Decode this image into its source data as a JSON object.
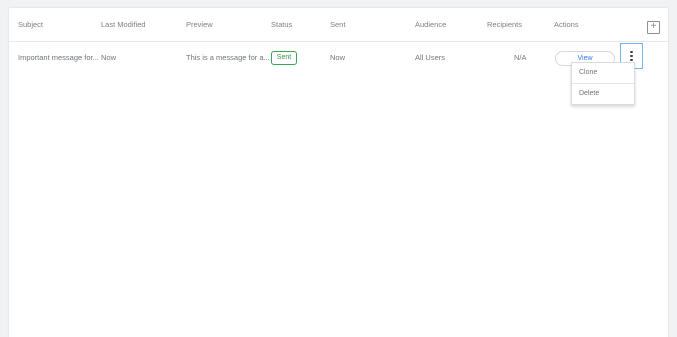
{
  "table": {
    "columns": [
      "Subject",
      "Last Modified",
      "Preview",
      "Status",
      "Sent",
      "Audience",
      "Recipients",
      "Actions"
    ],
    "rows": [
      {
        "subject": "Important message for...",
        "last_modified": "Now",
        "preview": "This is a message for a...",
        "status": "Sent",
        "sent": "Now",
        "audience": "All Users",
        "recipients": "N/A",
        "view_label": "View"
      }
    ]
  },
  "add_icon": "plus-icon",
  "more_icon": "vertical-ellipsis-icon",
  "actions_menu": {
    "items": [
      "Clone",
      "Delete"
    ]
  },
  "colors": {
    "status_sent": "#35a853",
    "link_blue": "#2d7be0",
    "focus_border": "#6fb5ea"
  }
}
